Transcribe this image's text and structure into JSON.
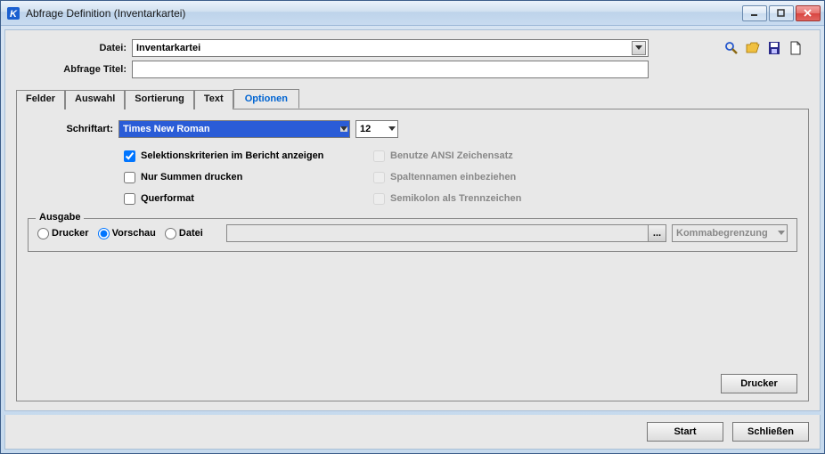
{
  "window": {
    "title": "Abfrage Definition (Inventarkartei)"
  },
  "fields": {
    "datei_label": "Datei:",
    "datei_value": "Inventarkartei",
    "abfrage_label": "Abfrage Titel:",
    "abfrage_value": ""
  },
  "tabs": {
    "felder": "Felder",
    "auswahl": "Auswahl",
    "sortierung": "Sortierung",
    "text": "Text",
    "optionen": "Optionen"
  },
  "options": {
    "schriftart_label": "Schriftart:",
    "font_name": "Times New Roman",
    "font_size": "12",
    "chk1": "Selektionskriterien im Bericht anzeigen",
    "chk2": "Nur Summen drucken",
    "chk3": "Querformat",
    "chk4": "Benutze ANSI Zeichensatz",
    "chk5": "Spaltennamen einbeziehen",
    "chk6": "Semikolon als Trennzeichen"
  },
  "output": {
    "legend": "Ausgabe",
    "radio_drucker": "Drucker",
    "radio_vorschau": "Vorschau",
    "radio_datei": "Datei",
    "browse": "...",
    "separator": "Kommabegrenzung"
  },
  "buttons": {
    "drucker": "Drucker",
    "start": "Start",
    "schliessen": "Schließen"
  },
  "icons": {
    "app": "K",
    "search": "search-icon",
    "open": "open-icon",
    "save": "save-icon",
    "new": "new-icon"
  }
}
